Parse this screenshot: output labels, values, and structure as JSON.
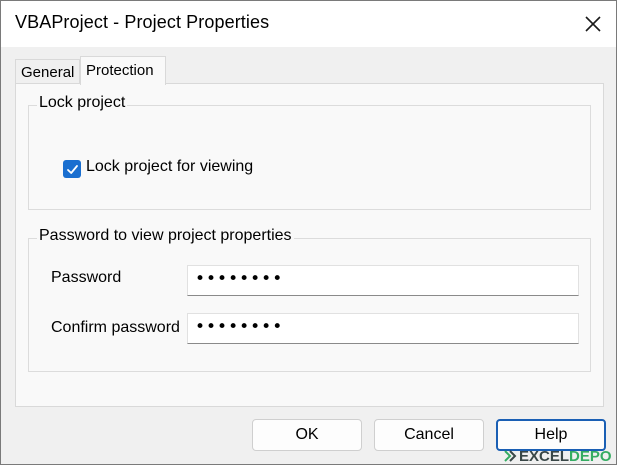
{
  "window": {
    "title": "VBAProject - Project Properties"
  },
  "tabs": [
    {
      "label": "General",
      "selected": false
    },
    {
      "label": "Protection",
      "selected": true
    }
  ],
  "lock_group": {
    "title": "Lock project",
    "checkbox_label": "Lock project for viewing",
    "checked": true
  },
  "password_group": {
    "title": "Password to view project properties",
    "password_label": "Password",
    "password_value": "••••••••",
    "confirm_label": "Confirm password",
    "confirm_value": "••••••••"
  },
  "buttons": {
    "ok": "OK",
    "cancel": "Cancel",
    "help": "Help"
  },
  "watermark": {
    "part1": "EXCEL",
    "part2": "DEPO"
  },
  "colors": {
    "accent": "#1a6fd0",
    "focus_border": "#1a5fb4",
    "watermark_green": "#15a14a"
  }
}
